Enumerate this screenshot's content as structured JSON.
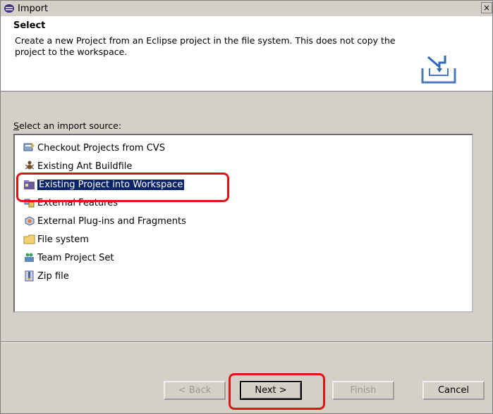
{
  "window": {
    "title": "Import",
    "close_label": "×"
  },
  "banner": {
    "heading": "Select",
    "description": "Create a new Project from an Eclipse project in the file system. This does not copy the project to the workspace."
  },
  "source_label": {
    "mnemonic": "S",
    "rest": "elect an import source:"
  },
  "sources": [
    {
      "label": "Checkout Projects from CVS",
      "icon": "cvs-icon"
    },
    {
      "label": "Existing Ant Buildfile",
      "icon": "ant-icon"
    },
    {
      "label": "Existing Project into Workspace",
      "icon": "project-icon",
      "selected": true
    },
    {
      "label": "External Features",
      "icon": "feature-icon"
    },
    {
      "label": "External Plug-ins and Fragments",
      "icon": "plugin-icon"
    },
    {
      "label": "File system",
      "icon": "folder-icon"
    },
    {
      "label": "Team Project Set",
      "icon": "team-icon"
    },
    {
      "label": "Zip file",
      "icon": "zip-icon"
    }
  ],
  "buttons": {
    "back": "< Back",
    "next": "Next >",
    "finish": "Finish",
    "cancel": "Cancel"
  },
  "colors": {
    "selection": "#0a246a",
    "highlight": "#e01414",
    "face": "#d4d0c8"
  }
}
